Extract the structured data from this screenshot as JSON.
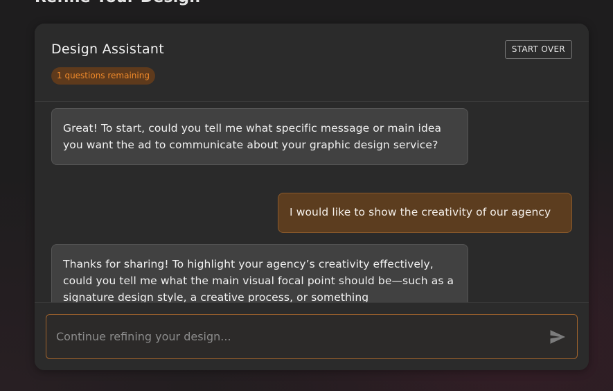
{
  "page": {
    "heading": "Refine Your Design"
  },
  "assistant_panel": {
    "title": "Design Assistant",
    "questions_remaining": "1 questions remaining",
    "start_over_label": "START OVER"
  },
  "messages": [
    {
      "role": "assistant",
      "text": "Great! To start, could you tell me what specific message or main idea you want the ad to communicate about your graphic design service?"
    },
    {
      "role": "user",
      "text": "I would like to show the creativity of our agency"
    },
    {
      "role": "assistant",
      "text": "Thanks for sharing! To highlight your agency’s creativity effectively, could you tell me what the main visual focal point should be—such as a signature design style, a creative process, or something"
    }
  ],
  "composer": {
    "placeholder": "Continue refining your design...",
    "value": "",
    "send_icon": "send-icon"
  },
  "colors": {
    "accent": "#f08a2a",
    "user_bubble": "#5c3d1f",
    "assistant_bubble": "#414141"
  }
}
